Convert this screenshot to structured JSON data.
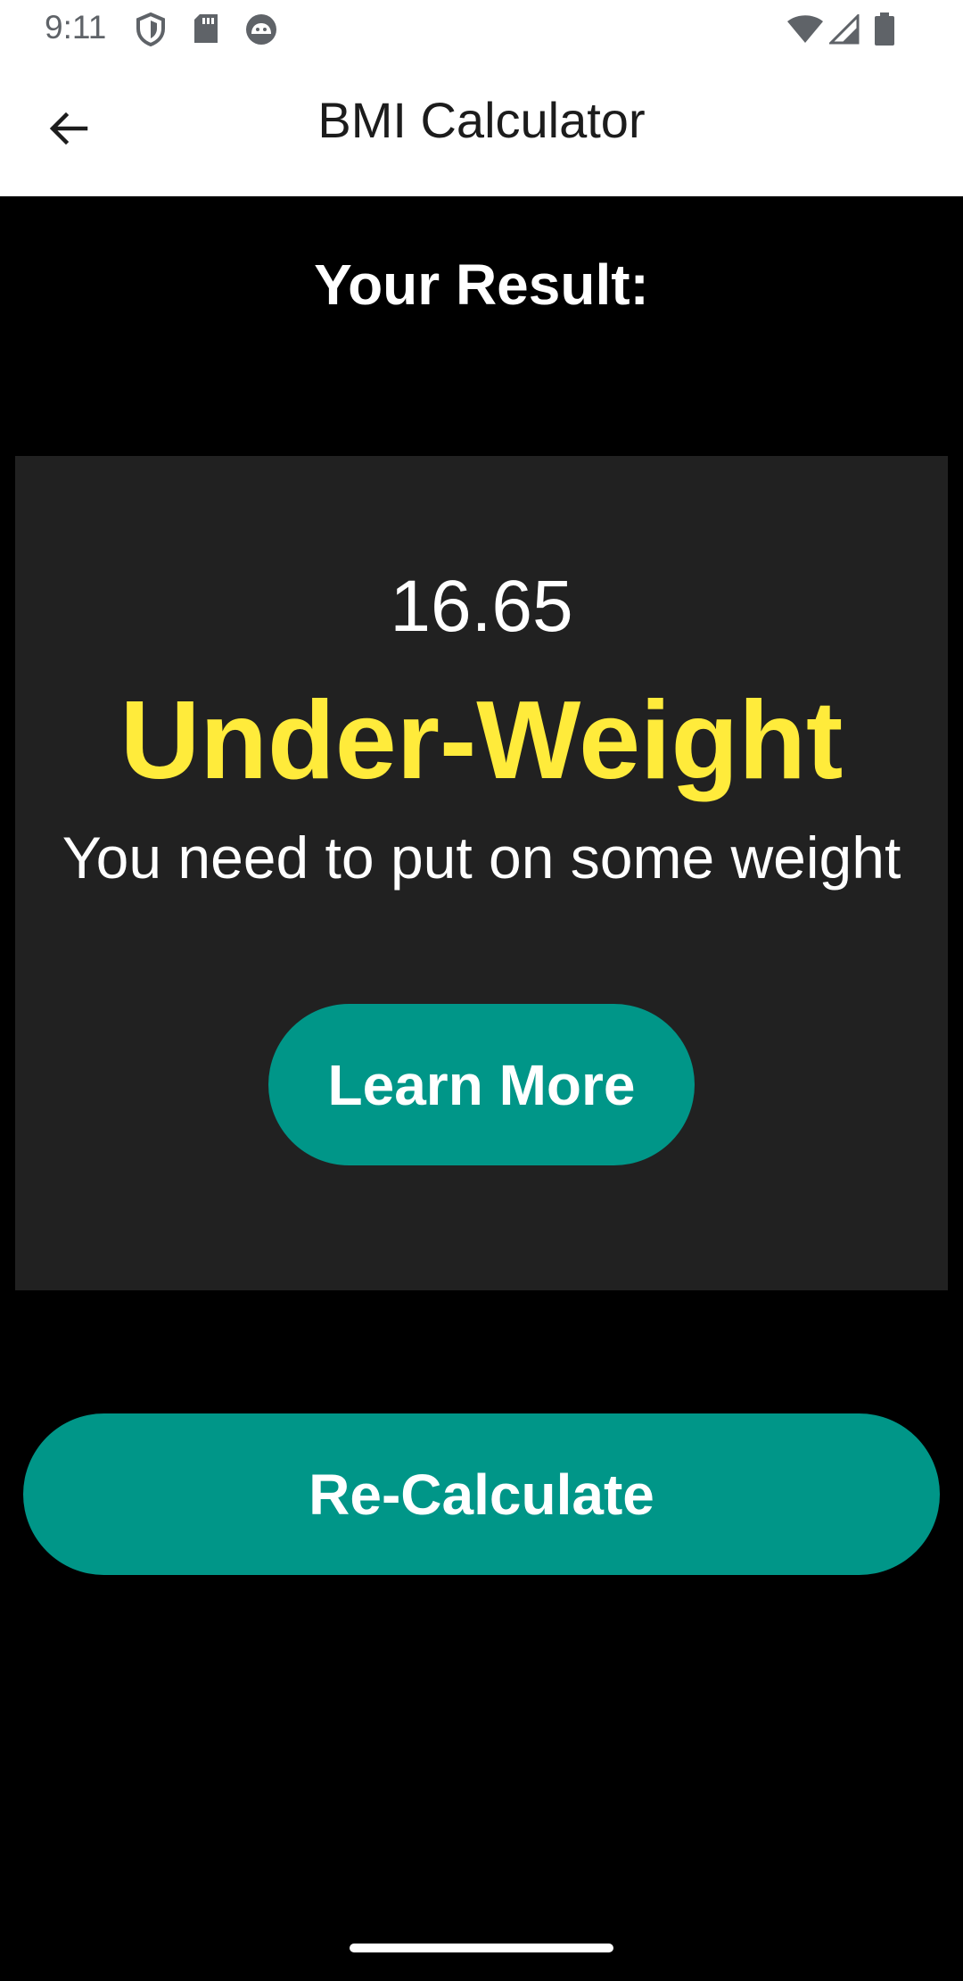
{
  "status_bar": {
    "time": "9:11",
    "left_icons": [
      "shield-icon",
      "sd-card-icon",
      "android-debug-icon"
    ],
    "right_icons": [
      "wifi-icon",
      "cellular-signal-icon",
      "battery-icon"
    ]
  },
  "app_bar": {
    "title": "BMI Calculator",
    "back_icon": "arrow-back-icon"
  },
  "result": {
    "heading": "Your Result:",
    "bmi_value": "16.65",
    "category": "Under-Weight",
    "advice": "You need to put on some weight",
    "learn_more_label": "Learn More"
  },
  "actions": {
    "recalculate_label": "Re-Calculate"
  },
  "colors": {
    "background": "#000000",
    "card": "#212121",
    "accent": "#009688",
    "category_text": "#ffeb3b",
    "app_bar": "#ffffff"
  }
}
